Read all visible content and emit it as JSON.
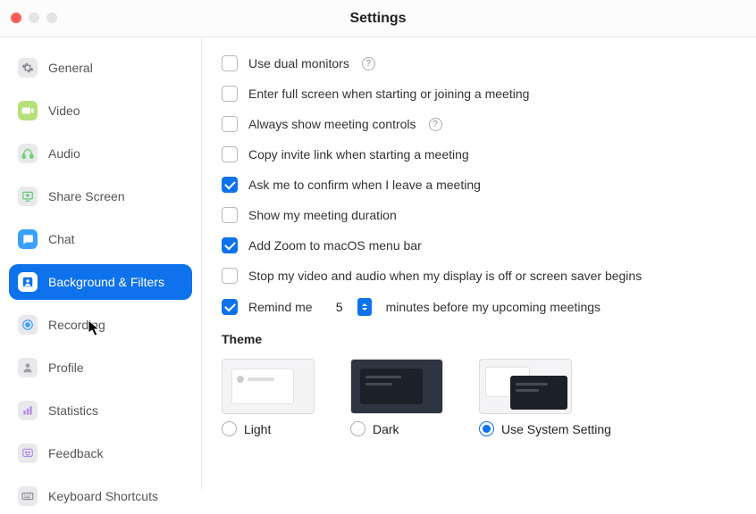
{
  "title": "Settings",
  "traffic": {
    "close": "close",
    "min": "minimize",
    "max": "maximize"
  },
  "sidebar": {
    "items": [
      {
        "id": "general",
        "label": "General",
        "icon": "gear-icon",
        "bg": "#e9e9ec",
        "fg": "#8a8a8e"
      },
      {
        "id": "video",
        "label": "Video",
        "icon": "video-icon",
        "bg": "#b7e07b",
        "fg": "#ffffff"
      },
      {
        "id": "audio",
        "label": "Audio",
        "icon": "audio-icon",
        "bg": "#e9e9ec",
        "fg": "#6fd47a"
      },
      {
        "id": "share",
        "label": "Share Screen",
        "icon": "share-screen-icon",
        "bg": "#e9e9ec",
        "fg": "#55c76b"
      },
      {
        "id": "chat",
        "label": "Chat",
        "icon": "chat-icon",
        "bg": "#3aa0ff",
        "fg": "#ffffff"
      },
      {
        "id": "bgfilters",
        "label": "Background & Filters",
        "icon": "background-icon",
        "bg": "#ffffff",
        "fg": "#0e72ec"
      },
      {
        "id": "recording",
        "label": "Recording",
        "icon": "recording-icon",
        "bg": "#e9e9ec",
        "fg": "#3aa0ff"
      },
      {
        "id": "profile",
        "label": "Profile",
        "icon": "profile-icon",
        "bg": "#e9e9ec",
        "fg": "#9aa0a6"
      },
      {
        "id": "statistics",
        "label": "Statistics",
        "icon": "statistics-icon",
        "bg": "#e9e9ec",
        "fg": "#b18be8"
      },
      {
        "id": "feedback",
        "label": "Feedback",
        "icon": "feedback-icon",
        "bg": "#e9e9ec",
        "fg": "#b18be8"
      },
      {
        "id": "shortcuts",
        "label": "Keyboard Shortcuts",
        "icon": "keyboard-icon",
        "bg": "#e9e9ec",
        "fg": "#8a8a8e"
      }
    ],
    "active": "bgfilters"
  },
  "options": {
    "dual_monitors": {
      "label": "Use dual monitors",
      "checked": false,
      "help": true
    },
    "fullscreen": {
      "label": "Enter full screen when starting or joining a meeting",
      "checked": false
    },
    "always_controls": {
      "label": "Always show meeting controls",
      "checked": false,
      "help": true
    },
    "copy_invite": {
      "label": "Copy invite link when starting a meeting",
      "checked": false
    },
    "confirm_leave": {
      "label": "Ask me to confirm when I leave a meeting",
      "checked": true
    },
    "show_duration": {
      "label": "Show my meeting duration",
      "checked": false
    },
    "menu_bar": {
      "label": "Add Zoom to macOS menu bar",
      "checked": true
    },
    "stop_on_sleep": {
      "label": "Stop my video and audio when my display is off or screen saver begins",
      "checked": false
    },
    "remind": {
      "prefix": "Remind me",
      "value": "5",
      "suffix": "minutes before my upcoming meetings",
      "checked": true
    }
  },
  "theme": {
    "label": "Theme",
    "options": [
      {
        "id": "light",
        "label": "Light"
      },
      {
        "id": "dark",
        "label": "Dark"
      },
      {
        "id": "system",
        "label": "Use System Setting"
      }
    ],
    "selected": "system"
  }
}
